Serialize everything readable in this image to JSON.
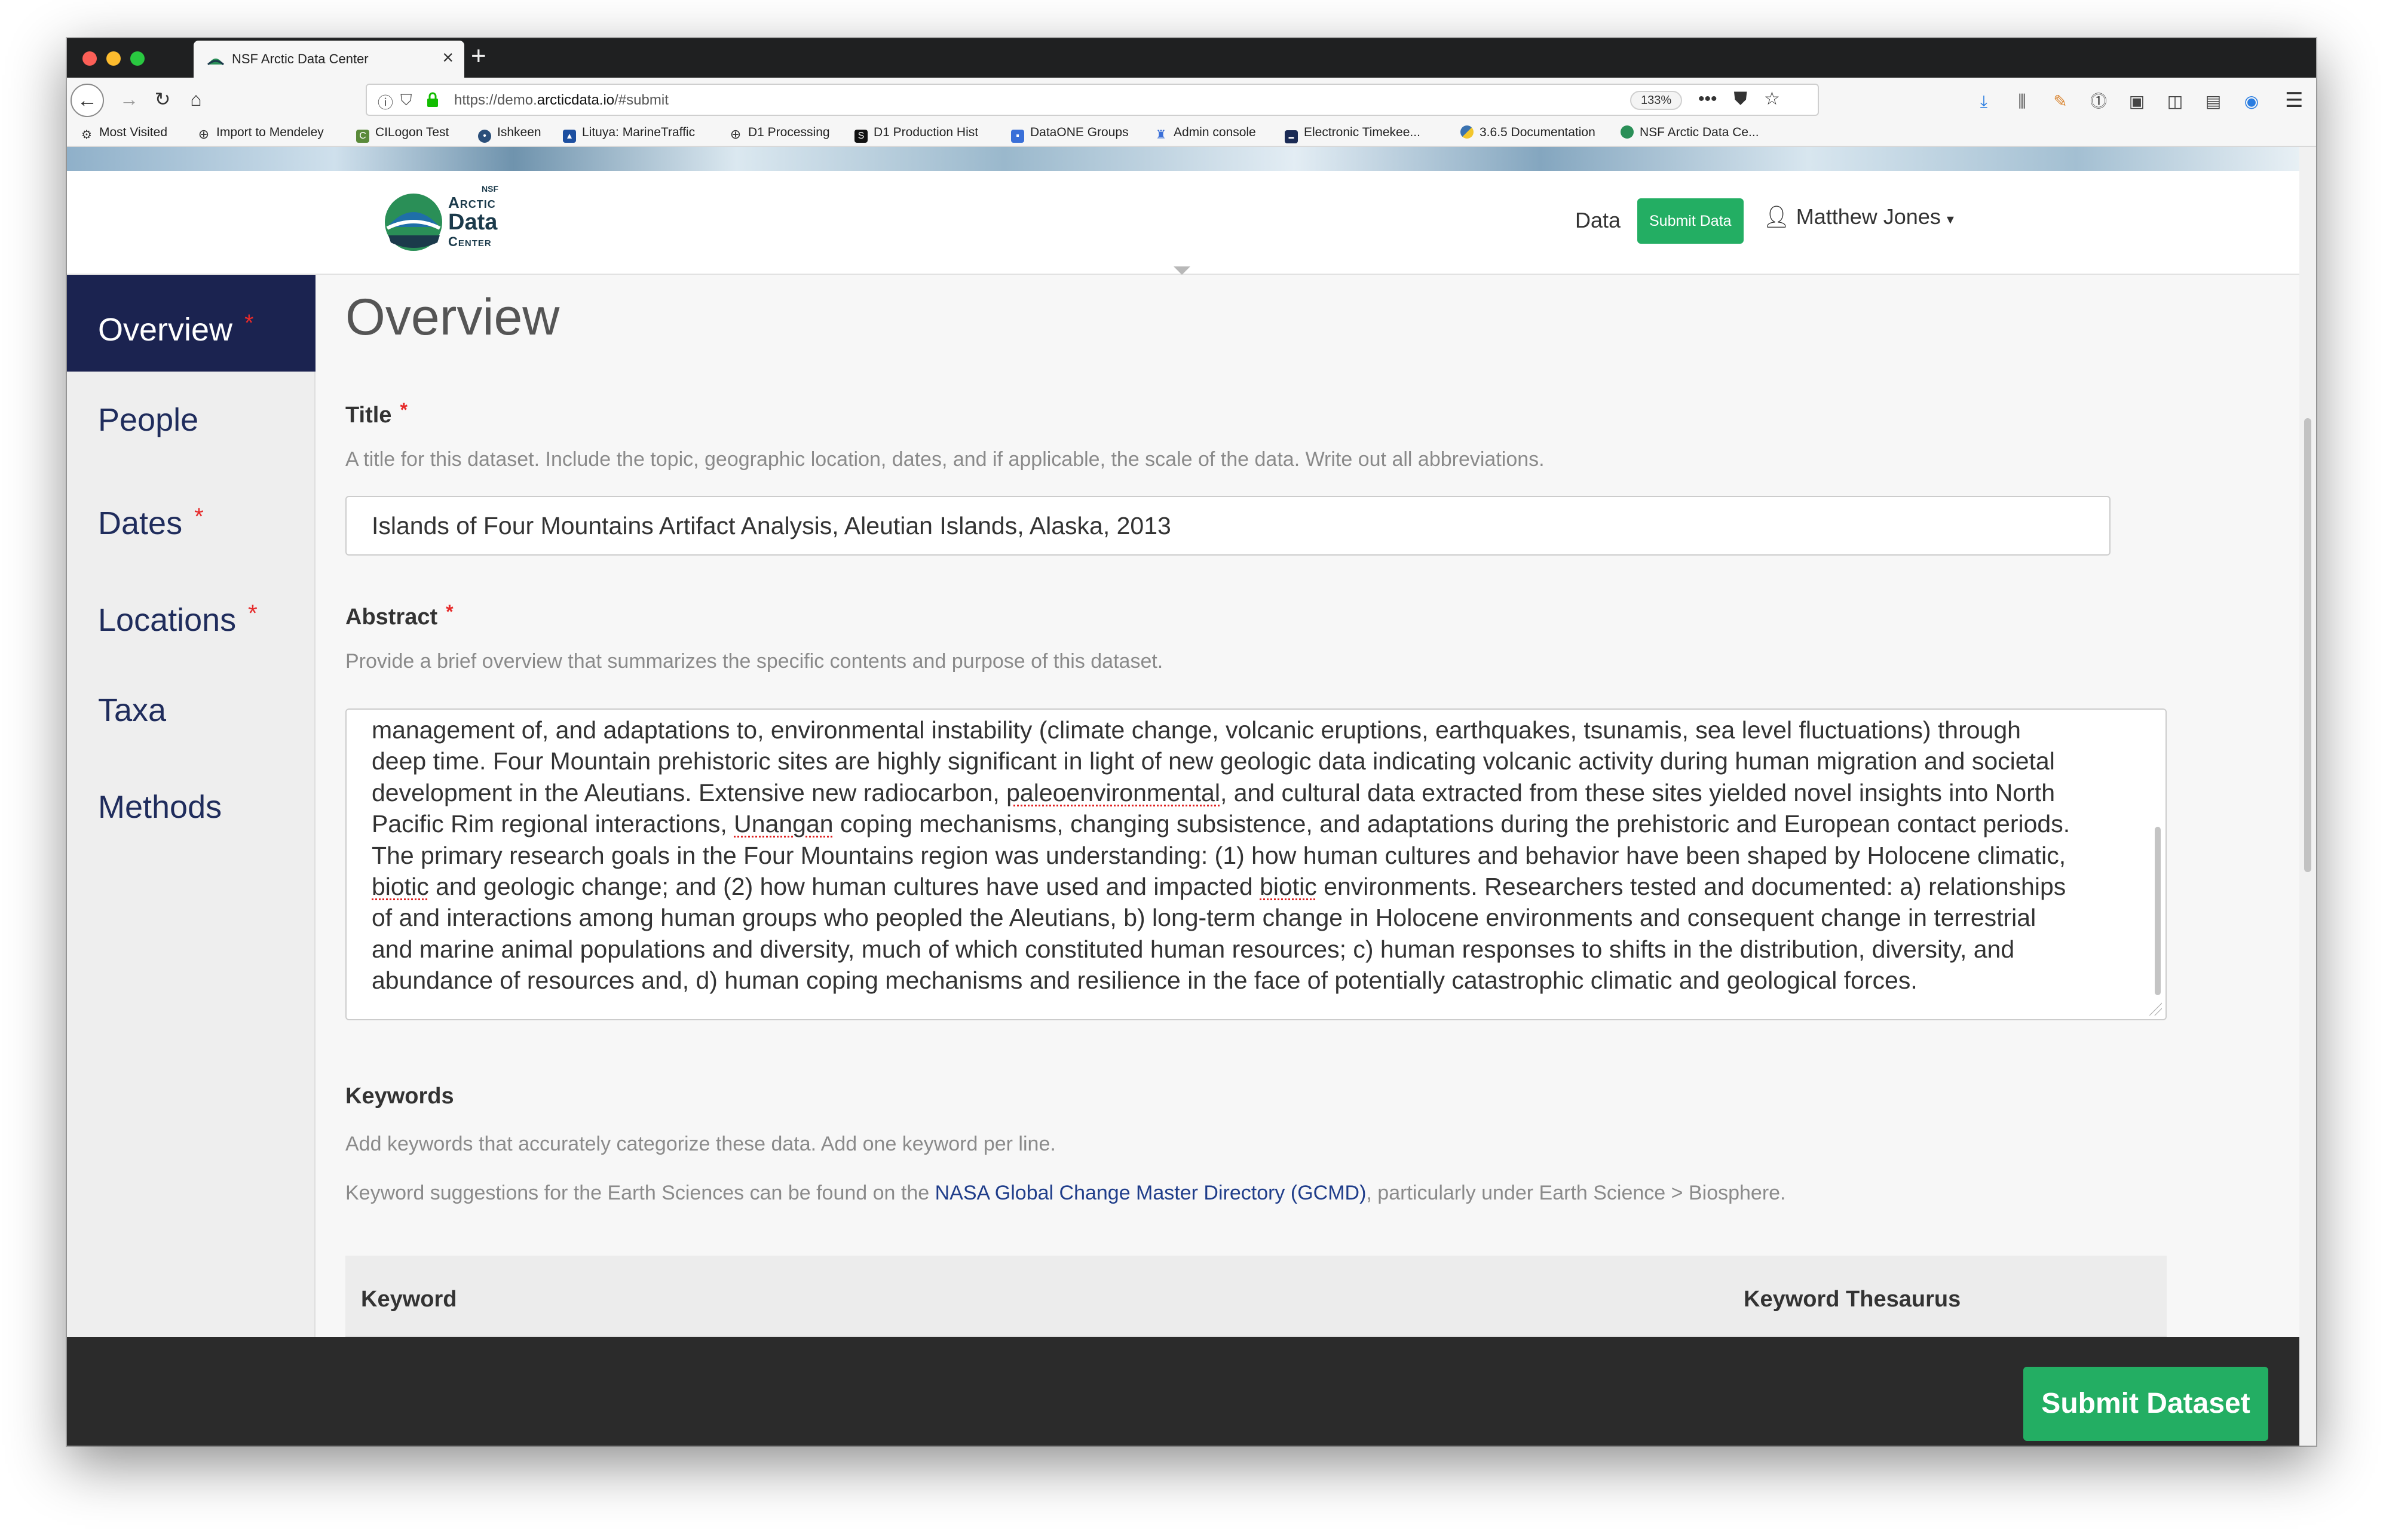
{
  "browser": {
    "tab_title": "NSF Arctic Data Center",
    "url_prefix": "https://demo.",
    "url_host": "arcticdata.io",
    "url_path": "/#submit",
    "zoom": "133%",
    "bookmarks": [
      "Most Visited",
      "Import to Mendeley",
      "CILogon Test",
      "Ishkeen",
      "Lituya: MarineTraffic",
      "D1 Processing",
      "D1 Production Hist",
      "DataONE Groups",
      "Admin console",
      "Electronic Timekee...",
      "3.6.5 Documentation",
      "NSF Arctic Data Ce..."
    ]
  },
  "header": {
    "logo_nsf": "NSF",
    "logo_line1": "Arctic",
    "logo_line2": "Data",
    "logo_line3": "Center",
    "nav_data": "Data",
    "nav_submit": "Submit Data",
    "user_name": "Matthew Jones"
  },
  "sidebar": {
    "items": [
      {
        "label": "Overview",
        "required": "*"
      },
      {
        "label": "People",
        "required": ""
      },
      {
        "label": "Dates",
        "required": "*"
      },
      {
        "label": "Locations",
        "required": "*"
      },
      {
        "label": "Taxa",
        "required": ""
      },
      {
        "label": "Methods",
        "required": ""
      }
    ]
  },
  "form": {
    "heading": "Overview",
    "title_label": "Title",
    "required_mark": "*",
    "title_help": "A title for this dataset. Include the topic, geographic location, dates, and if applicable, the scale of the data. Write out all abbreviations.",
    "title_value": "Islands of Four Mountains Artifact Analysis, Aleutian Islands, Alaska, 2013",
    "abstract_label": "Abstract",
    "abstract_help": "Provide a brief overview that summarizes the specific contents and purpose of this dataset.",
    "abstract_lines": [
      "management of, and adaptations to, environmental instability (climate change, volcanic eruptions, earthquakes, tsunamis, sea level fluctuations) through",
      "deep time. Four Mountain prehistoric sites are highly significant in light of new geologic data indicating volcanic activity during human migration and societal",
      "development in the Aleutians. Extensive new radiocarbon, paleoenvironmental, and cultural data extracted from these sites yielded novel insights into North",
      "Pacific Rim regional interactions, Unangan coping mechanisms, changing subsistence, and adaptations during the prehistoric and European contact periods.",
      "The primary research goals in the Four Mountains region was understanding: (1) how human cultures and behavior have been shaped by Holocene climatic,",
      "biotic and geologic change; and (2) how human cultures have used and impacted biotic environments. Researchers tested and documented: a) relationships",
      "of and interactions among human groups who peopled the Aleutians, b) long-term change in Holocene environments and consequent change in terrestrial",
      "and marine animal populations and diversity, much of which constituted human resources; c) human responses to shifts in the distribution, diversity, and",
      "abundance of resources and, d) human coping mechanisms and resilience in the face of potentially catastrophic climatic and geological forces."
    ],
    "keywords_label": "Keywords",
    "keywords_help": "Add keywords that accurately categorize these data. Add one keyword per line.",
    "keywords_suggest_before": "Keyword suggestions for the Earth Sciences can be found on the ",
    "keywords_suggest_link": "NASA Global Change Master Directory (GCMD)",
    "keywords_suggest_after": ", particularly under Earth Science > Biosphere.",
    "kw_col_keyword": "Keyword",
    "kw_col_thesaurus": "Keyword Thesaurus"
  },
  "footer": {
    "submit_label": "Submit Dataset"
  },
  "colors": {
    "accent_green": "#23ae63",
    "sidebar_active": "#1b2350",
    "required_red": "#e62a2a",
    "link_blue": "#1f3d8a"
  }
}
